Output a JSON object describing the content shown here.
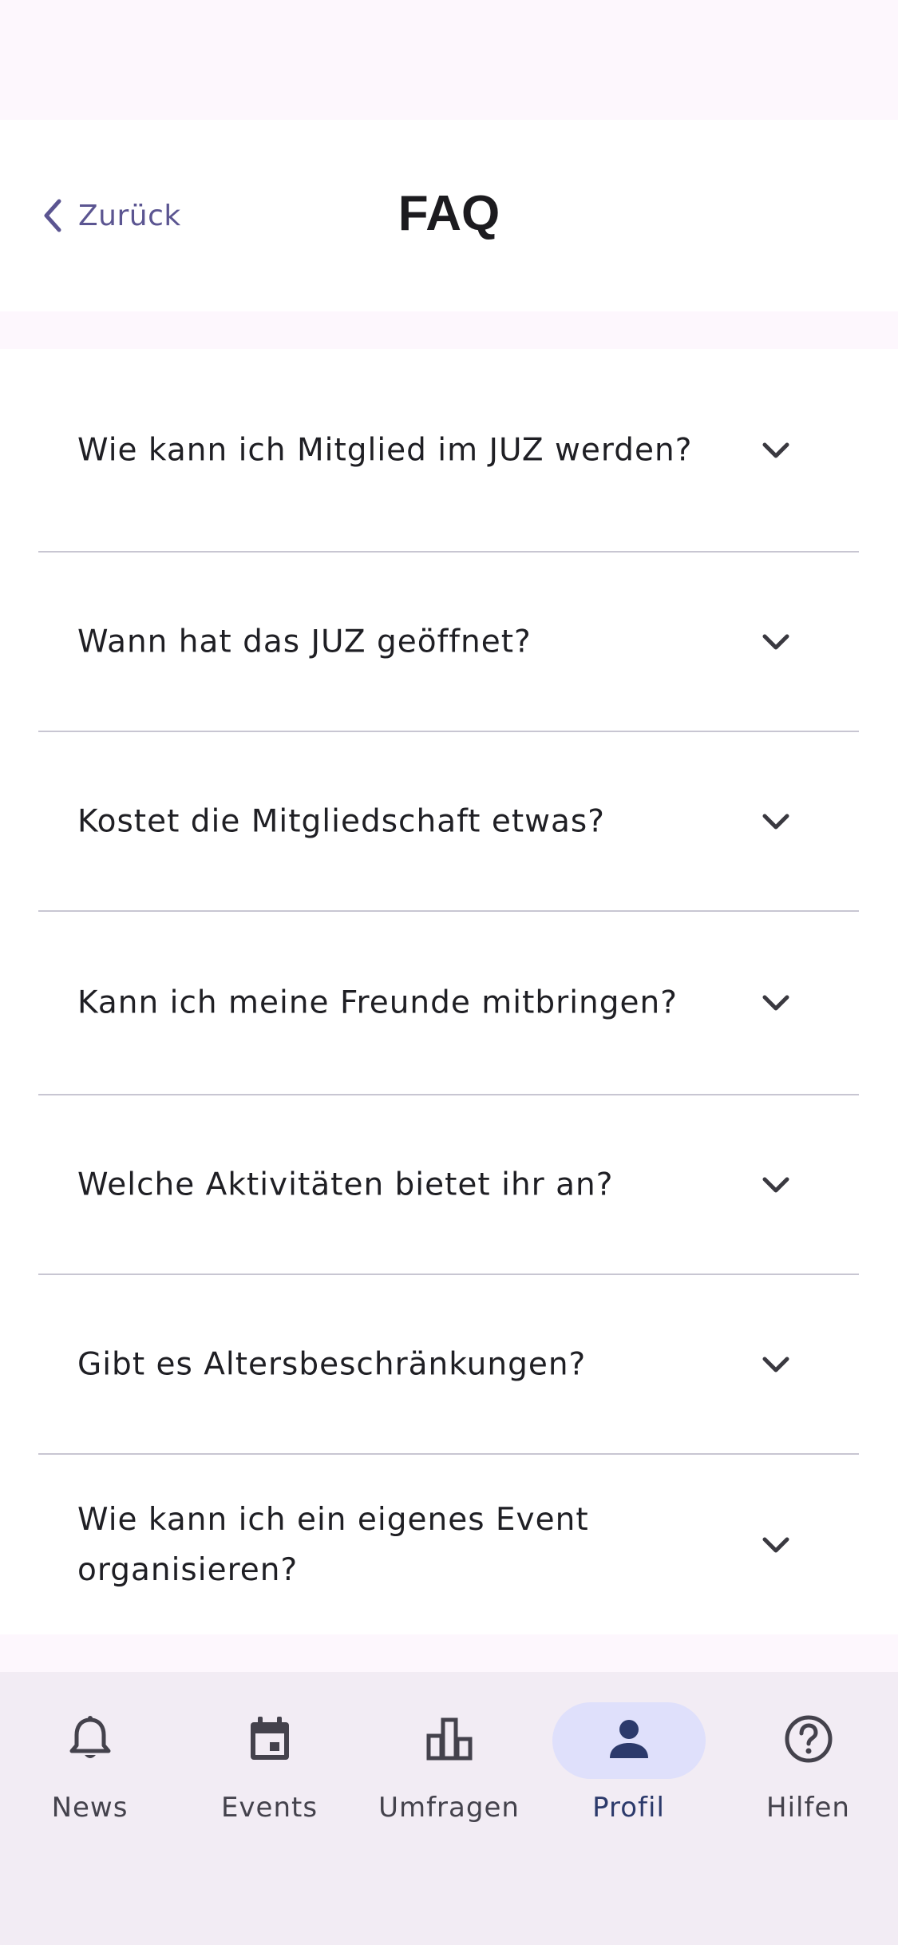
{
  "header": {
    "back_label": "Zurück",
    "title": "FAQ"
  },
  "faq": [
    {
      "question": "Wie kann ich Mitglied im JUZ werden?"
    },
    {
      "question": "Wann hat das JUZ geöffnet?"
    },
    {
      "question": "Kostet die Mitgliedschaft etwas?"
    },
    {
      "question": "Kann ich meine Freunde mitbringen?"
    },
    {
      "question": "Welche Aktivitäten bietet ihr an?"
    },
    {
      "question": "Gibt es Altersbeschränkungen?"
    },
    {
      "question": "Wie kann ich ein eigenes Event organisieren?"
    }
  ],
  "nav": {
    "items": [
      {
        "label": "News",
        "icon": "bell-icon"
      },
      {
        "label": "Events",
        "icon": "calendar-icon"
      },
      {
        "label": "Umfragen",
        "icon": "bar-chart-icon"
      },
      {
        "label": "Profil",
        "icon": "person-icon",
        "active": true
      },
      {
        "label": "Hilfen",
        "icon": "help-circle-icon"
      }
    ]
  },
  "colors": {
    "accent": "#5b5591",
    "active_nav_bg": "#dfe0fb",
    "active_nav_text": "#2c3a6b",
    "nav_bg": "#f2ecf4",
    "page_bg": "#fdf7fd"
  }
}
